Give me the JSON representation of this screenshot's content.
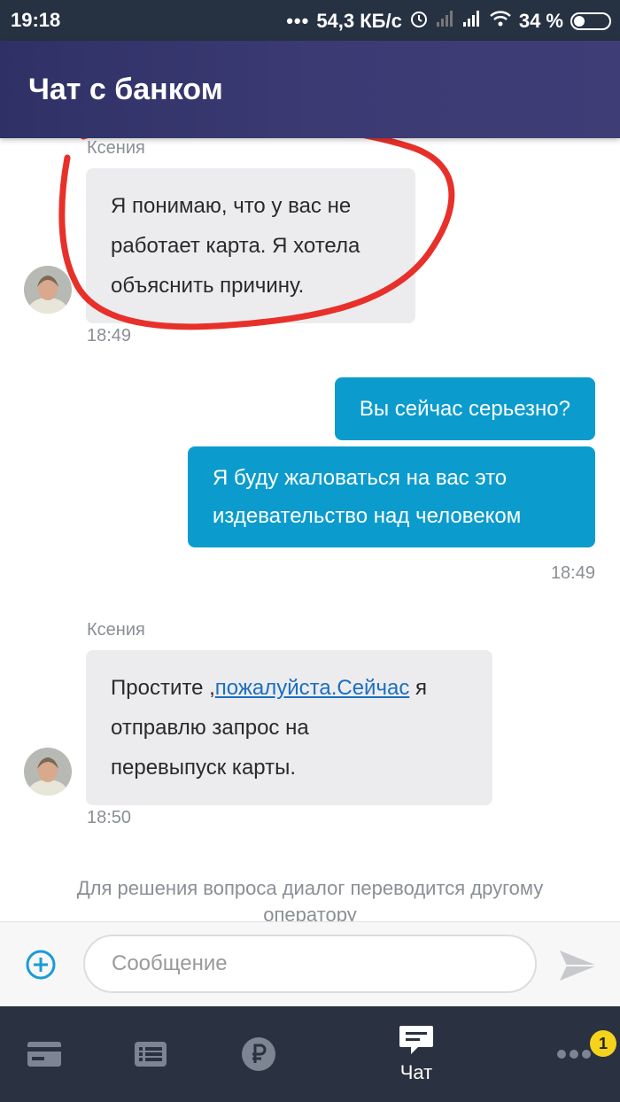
{
  "status_bar": {
    "time": "19:18",
    "net_speed": "54,3 КБ/с",
    "battery": "34 %",
    "icons": [
      "dots-icon",
      "alarm-icon",
      "signal-icon",
      "signal-icon",
      "wifi-icon",
      "battery-icon"
    ]
  },
  "header": {
    "title": "Чат с банком"
  },
  "messages": [
    {
      "from": "operator",
      "sender": "Ксения",
      "lines": [
        "Я понимаю, что у вас не",
        "работает карта. Я хотела",
        "объяснить причину."
      ],
      "time": "18:49"
    },
    {
      "from": "user",
      "text": "Вы сейчас серьезно?"
    },
    {
      "from": "user",
      "lines": [
        "Я буду жаловаться на вас это",
        "издевательство над человеком"
      ],
      "time": "18:49"
    },
    {
      "from": "operator",
      "sender": "Ксения",
      "line1_prefix": "Простите ,",
      "line1_link": "пожалуйста.Сейчас",
      "line1_suffix": " я",
      "lines_rest": [
        "отправлю запрос на",
        "перевыпуск карты."
      ],
      "time": "18:50"
    }
  ],
  "system_note": "Для решения вопроса диалог переводится другому оператору",
  "input": {
    "placeholder": "Сообщение",
    "value": ""
  },
  "bottom_nav": {
    "items": [
      {
        "icon": "card-icon"
      },
      {
        "icon": "list-icon"
      },
      {
        "icon": "ruble-icon"
      },
      {
        "icon": "chat-icon",
        "label": "Чат",
        "active": true
      },
      {
        "icon": "more-icon",
        "badge": "1"
      }
    ]
  },
  "colors": {
    "header": "#3b3a73",
    "user_bubble": "#0b9ccd",
    "operator_bubble": "#ececee",
    "annotation": "#e8302a",
    "badge": "#f5d21c"
  }
}
